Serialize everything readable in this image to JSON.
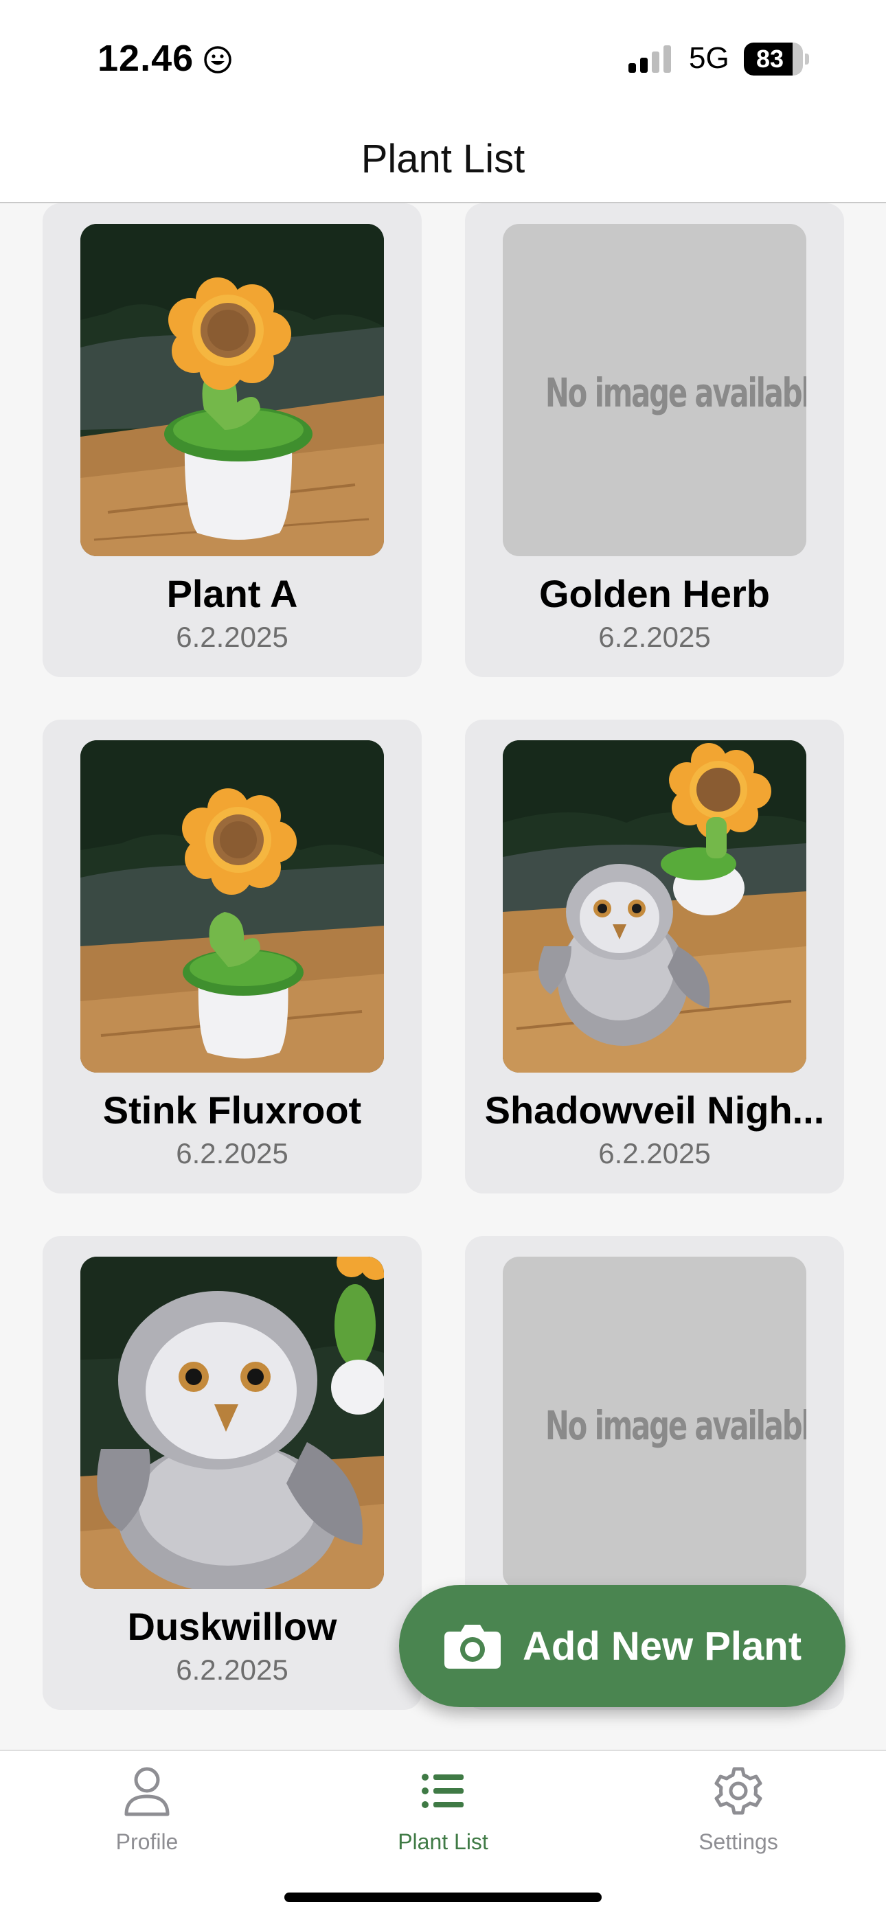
{
  "status_bar": {
    "time": "12.46",
    "network": "5G",
    "battery": "83",
    "battery_level": 0.83
  },
  "header": {
    "title": "Plant List"
  },
  "plants": [
    {
      "name": "Plant A",
      "date": "6.2.2025",
      "image": "sunflower-photo"
    },
    {
      "name": "Golden Herb",
      "date": "6.2.2025",
      "image": "placeholder",
      "placeholder_text": "No image available"
    },
    {
      "name": "Stink Fluxroot",
      "date": "6.2.2025",
      "image": "sunflower-photo"
    },
    {
      "name": "Shadowveil Nigh...",
      "date": "6.2.2025",
      "image": "owl-photo"
    },
    {
      "name": "Duskwillow",
      "date": "6.2.2025",
      "image": "owl-closeup-photo"
    },
    {
      "name": "",
      "date": "",
      "image": "placeholder",
      "placeholder_text": "No image available"
    }
  ],
  "fab": {
    "label": "Add New Plant",
    "icon": "camera-icon",
    "color": "#4a8550"
  },
  "tabs": [
    {
      "label": "Profile",
      "icon": "person-icon",
      "active": false
    },
    {
      "label": "Plant List",
      "icon": "list-icon",
      "active": true
    },
    {
      "label": "Settings",
      "icon": "gear-icon",
      "active": false
    }
  ],
  "colors": {
    "accent": "#3f7a45",
    "card_bg": "#e9e9eb",
    "placeholder_bg": "#c8c8c8"
  }
}
